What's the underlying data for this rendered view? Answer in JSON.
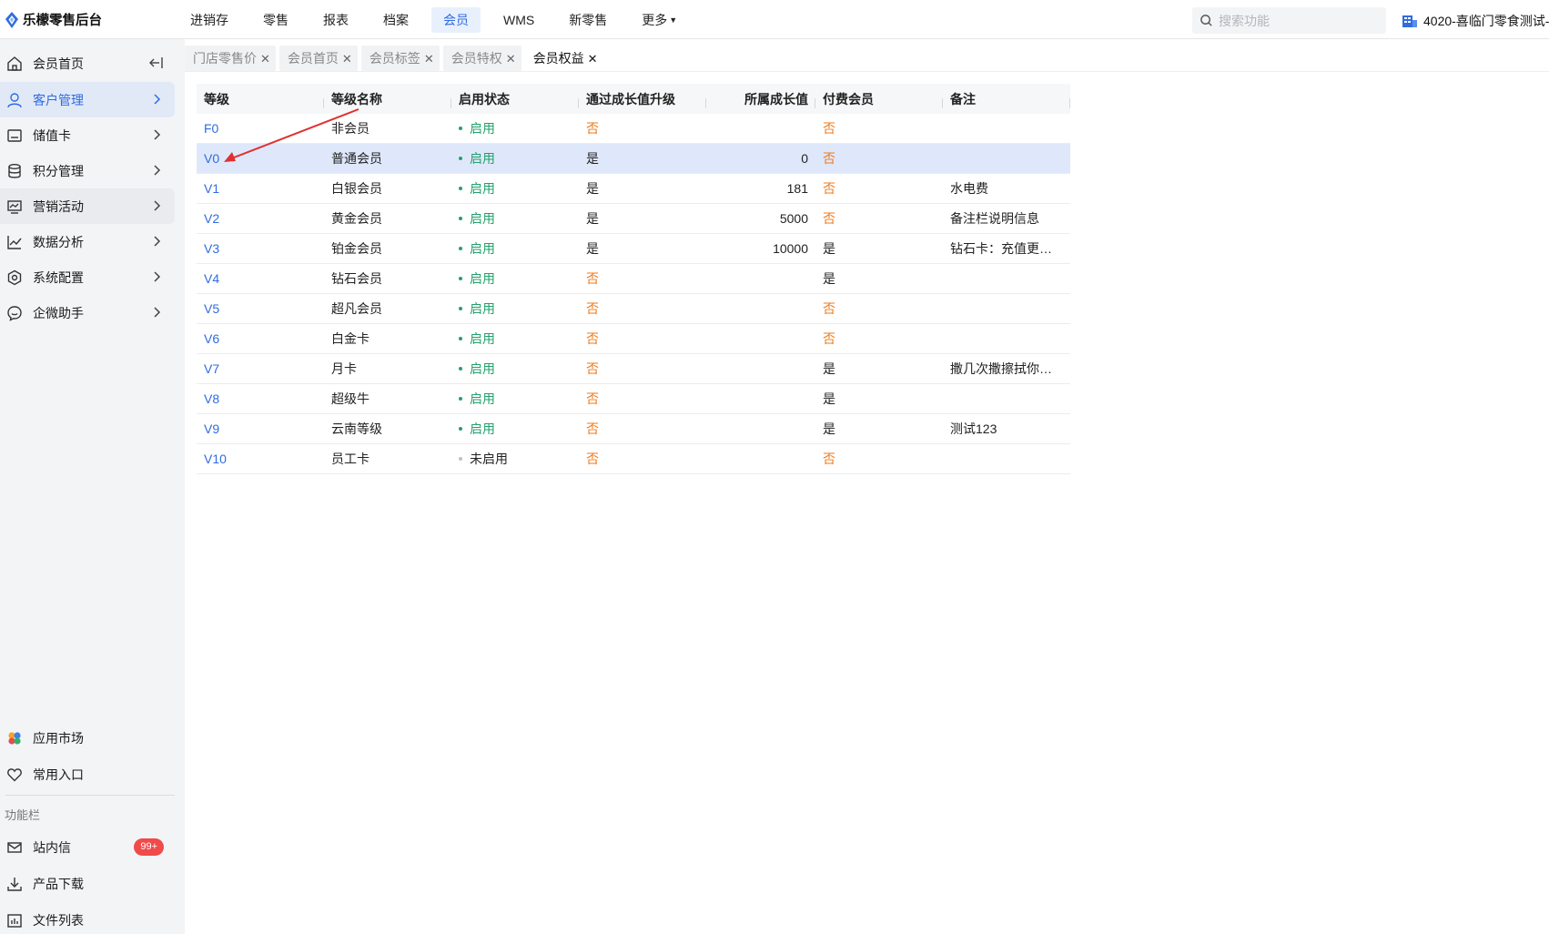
{
  "brand": {
    "name": "乐檬零售后台"
  },
  "topnav": [
    {
      "label": "进销存",
      "active": false
    },
    {
      "label": "零售",
      "active": false
    },
    {
      "label": "报表",
      "active": false
    },
    {
      "label": "档案",
      "active": false
    },
    {
      "label": "会员",
      "active": true
    },
    {
      "label": "WMS",
      "active": false
    },
    {
      "label": "新零售",
      "active": false
    },
    {
      "label": "更多",
      "active": false
    }
  ],
  "search": {
    "placeholder": "搜索功能"
  },
  "store": {
    "name": "4020-喜临门零食测试-"
  },
  "sidebar": {
    "items": [
      {
        "label": "会员首页"
      },
      {
        "label": "客户管理"
      },
      {
        "label": "储值卡"
      },
      {
        "label": "积分管理"
      },
      {
        "label": "营销活动"
      },
      {
        "label": "数据分析"
      },
      {
        "label": "系统配置"
      },
      {
        "label": "企微助手"
      }
    ],
    "bottom": [
      {
        "label": "应用市场"
      },
      {
        "label": "常用入口"
      }
    ],
    "section_label": "功能栏",
    "tools": [
      {
        "label": "站内信",
        "badge": "99+"
      },
      {
        "label": "产品下载"
      },
      {
        "label": "文件列表"
      }
    ]
  },
  "tabs": [
    {
      "label": "门店零售价",
      "active": false
    },
    {
      "label": "会员首页",
      "active": false
    },
    {
      "label": "会员标签",
      "active": false
    },
    {
      "label": "会员特权",
      "active": false
    },
    {
      "label": "会员权益",
      "active": true
    }
  ],
  "table": {
    "headers": [
      "等级",
      "等级名称",
      "启用状态",
      "通过成长值升级",
      "所属成长值",
      "付费会员",
      "备注"
    ],
    "rows": [
      {
        "level": "F0",
        "name": "非会员",
        "status": "启用",
        "upgrade": "否",
        "growth": "",
        "paid": "否",
        "note": ""
      },
      {
        "level": "V0",
        "name": "普通会员",
        "status": "启用",
        "upgrade": "是",
        "growth": "0",
        "paid": "否",
        "note": ""
      },
      {
        "level": "V1",
        "name": "白银会员",
        "status": "启用",
        "upgrade": "是",
        "growth": "181",
        "paid": "否",
        "note": "水电费"
      },
      {
        "level": "V2",
        "name": "黄金会员",
        "status": "启用",
        "upgrade": "是",
        "growth": "5000",
        "paid": "否",
        "note": "备注栏说明信息"
      },
      {
        "level": "V3",
        "name": "铂金会员",
        "status": "启用",
        "upgrade": "是",
        "growth": "10000",
        "paid": "是",
        "note": "钻石卡：充值更…"
      },
      {
        "level": "V4",
        "name": "钻石会员",
        "status": "启用",
        "upgrade": "否",
        "growth": "",
        "paid": "是",
        "note": ""
      },
      {
        "level": "V5",
        "name": "超凡会员",
        "status": "启用",
        "upgrade": "否",
        "growth": "",
        "paid": "否",
        "note": ""
      },
      {
        "level": "V6",
        "name": "白金卡",
        "status": "启用",
        "upgrade": "否",
        "growth": "",
        "paid": "否",
        "note": ""
      },
      {
        "level": "V7",
        "name": "月卡",
        "status": "启用",
        "upgrade": "否",
        "growth": "",
        "paid": "是",
        "note": "撒几次撒擦拭你…"
      },
      {
        "level": "V8",
        "name": "超级牛",
        "status": "启用",
        "upgrade": "否",
        "growth": "",
        "paid": "是",
        "note": ""
      },
      {
        "level": "V9",
        "name": "云南等级",
        "status": "启用",
        "upgrade": "否",
        "growth": "",
        "paid": "是",
        "note": "测试123"
      },
      {
        "level": "V10",
        "name": "员工卡",
        "status": "未启用",
        "upgrade": "否",
        "growth": "",
        "paid": "否",
        "note": ""
      }
    ]
  },
  "colors": {
    "accent": "#2f6ce0",
    "enabled": "#22a06b",
    "no": "#f07a1a",
    "annotation": "#e03030"
  }
}
